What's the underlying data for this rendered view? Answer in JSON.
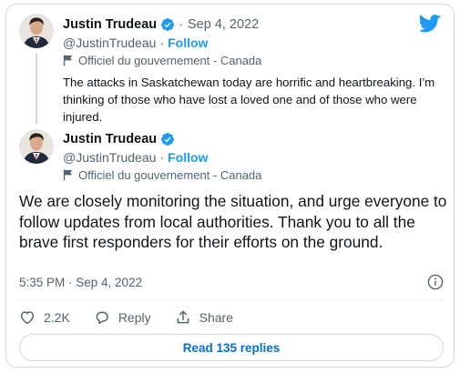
{
  "parent_tweet": {
    "author_name": "Justin Trudeau",
    "separator": "·",
    "date": "Sep 4, 2022",
    "handle": "@JustinTrudeau",
    "dot": "·",
    "follow_label": "Follow",
    "affiliation": "Officiel du gouvernement - Canada",
    "text": "The attacks in Saskatchewan today are horrific and heartbreaking. I’m thinking of those who have lost a loved one and of those who were injured."
  },
  "main_tweet": {
    "author_name": "Justin Trudeau",
    "handle": "@JustinTrudeau",
    "dot": "·",
    "follow_label": "Follow",
    "affiliation": "Officiel du gouvernement - Canada",
    "text": "We are closely monitoring the situation, and urge everyone to follow updates from local authorities. Thank you to all the brave first responders for their efforts on the ground.",
    "timestamp": "5:35 PM · Sep 4, 2022"
  },
  "actions": {
    "like_count": "2.2K",
    "reply_label": "Reply",
    "share_label": "Share"
  },
  "read_replies_label": "Read 135 replies",
  "colors": {
    "accent": "#1d9bf0",
    "link": "#006fd6",
    "secondary_text": "#536471",
    "border": "#cfd9de"
  },
  "icons": [
    "twitter-logo-icon",
    "verified-badge-icon",
    "flag-icon",
    "info-icon",
    "heart-icon",
    "reply-icon",
    "share-icon"
  ]
}
